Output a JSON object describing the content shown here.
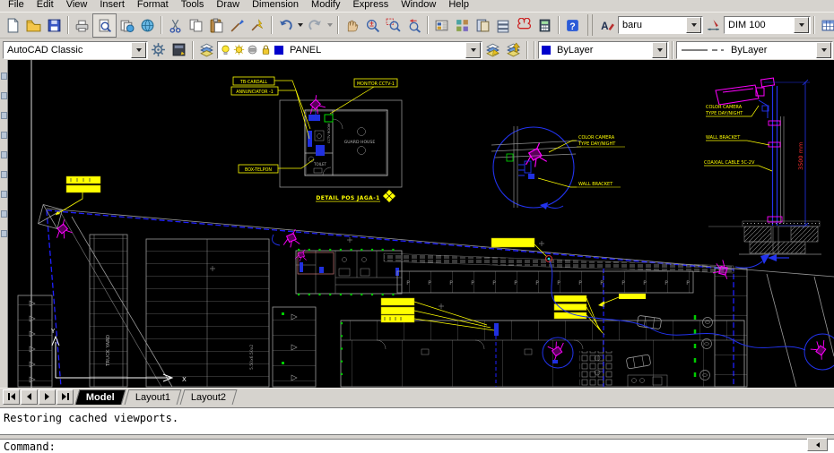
{
  "menu": {
    "items": [
      "File",
      "Edit",
      "View",
      "Insert",
      "Format",
      "Tools",
      "Draw",
      "Dimension",
      "Modify",
      "Express",
      "Window",
      "Help"
    ]
  },
  "toolbars": {
    "standard_icons": [
      "new",
      "open",
      "save",
      "plot",
      "plot-preview",
      "publish",
      "dwf",
      "cut",
      "copy",
      "paste",
      "match-properties",
      "block-editor",
      "undo",
      "redo",
      "pan-realtime",
      "zoom-realtime",
      "zoom-window",
      "zoom-previous",
      "properties",
      "design-center",
      "tool-palettes",
      "sheet-set-manager",
      "markup-set-manager",
      "quickcalc",
      "help"
    ],
    "styles": {
      "text_style": "baru",
      "dim_style": "DIM 100"
    },
    "workspaces": {
      "current": "AutoCAD Classic"
    },
    "layers": {
      "current": "PANEL"
    },
    "properties": {
      "color": "ByLayer",
      "linetype": "ByLayer"
    }
  },
  "glyphs": {
    "help": "?",
    "letter_a": "A"
  },
  "tabs": {
    "model": "Model",
    "layout1": "Layout1",
    "layout2": "Layout2"
  },
  "command": {
    "history": "Restoring cached viewports.",
    "prompt": "Command:"
  },
  "drawing": {
    "guard_detail": {
      "label_tb": "TB-CARDALL",
      "label_annunciator": "ANNUNCIATOR -1",
      "label_monitor": "MONITOR CCTV-1",
      "label_box": "BOX-TELPON",
      "room_guard": "GUARD HOUSE",
      "room_toilet": "TOILET",
      "room_cctv": "CCTV ROOM",
      "title": "DETAIL POS JAGA-1"
    },
    "circle_detail": {
      "label_camera_1": "COLOR CAMERA",
      "label_camera_2": "TYPE DAY/NIGHT",
      "label_bracket": "WALL BRACKET"
    },
    "pole_detail": {
      "label_camera_1": "COLOR CAMERA",
      "label_camera_2": "TYPE DAY/NIGHT",
      "label_bracket": "WALL BRACKET",
      "label_cable": "COAXIAL CABLE 5C-2V",
      "dim_height": "3500 mm"
    },
    "plan": {
      "truck_yard": "TRUCK YARD",
      "grid_note": "5.50x6.50x2",
      "stall_letter": "P",
      "ucs_x": "X",
      "ucs_y": "Y"
    }
  },
  "colors": {
    "chrome_bg": "#d6d3ce",
    "canvas_bg": "#000000",
    "cad_yellow": "#ffff00",
    "cad_magenta": "#ff00ff",
    "cad_blue": "#2233ee",
    "cad_gray": "#9a9a9a",
    "cad_green": "#00cc00",
    "dim_red": "#ff3030",
    "layer_swatch": "#0000cc"
  }
}
